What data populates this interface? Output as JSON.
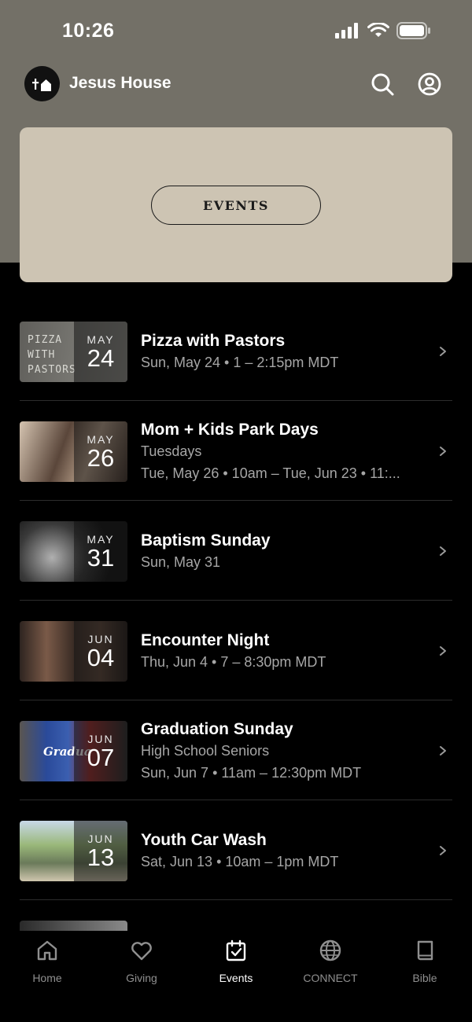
{
  "status_bar": {
    "time": "10:26"
  },
  "header": {
    "church_name": "Jesus House"
  },
  "hero": {
    "events_label": "EVENTS"
  },
  "events": [
    {
      "month": "MAY",
      "day": "24",
      "title": "Pizza with Pastors",
      "lines": [
        "Sun, May 24 • 1 – 2:15pm MDT"
      ],
      "thumb_colors": [
        "#6a6a66",
        "#8a8983"
      ],
      "thumb_text": "PIZZA WITH PASTORS"
    },
    {
      "month": "MAY",
      "day": "26",
      "title": "Mom + Kids Park Days",
      "lines": [
        "Tuesdays",
        "Tue, May 26 • 10am – Tue, Jun 23 • 11:..."
      ],
      "thumb_colors": [
        "#c9b8a6",
        "#4a3b32"
      ]
    },
    {
      "month": "MAY",
      "day": "31",
      "title": "Baptism Sunday",
      "lines": [
        "Sun, May 31"
      ],
      "thumb_colors": [
        "#1a1a1a",
        "#9a9a9a"
      ]
    },
    {
      "month": "JUN",
      "day": "04",
      "title": "Encounter Night",
      "lines": [
        "Thu, Jun 4 • 7 – 8:30pm MDT"
      ],
      "thumb_colors": [
        "#3b2f29",
        "#7a5a48"
      ]
    },
    {
      "month": "JUN",
      "day": "07",
      "title": "Graduation Sunday",
      "lines": [
        "High School Seniors",
        "Sun, Jun 7 • 11am – 12:30pm MDT"
      ],
      "thumb_colors": [
        "#2a4a8a",
        "#8a2a2a"
      ],
      "thumb_text": "Gradua"
    },
    {
      "month": "JUN",
      "day": "13",
      "title": "Youth Car Wash",
      "lines": [
        "Sat, Jun 13 • 10am – 1pm MDT"
      ],
      "thumb_colors": [
        "#8aa86a",
        "#c9c0a0"
      ]
    }
  ],
  "tabs": [
    {
      "label": "Home",
      "icon": "home-icon",
      "active": false
    },
    {
      "label": "Giving",
      "icon": "heart-icon",
      "active": false
    },
    {
      "label": "Events",
      "icon": "calendar-check-icon",
      "active": true
    },
    {
      "label": "CONNECT",
      "icon": "globe-icon",
      "active": false
    },
    {
      "label": "Bible",
      "icon": "book-icon",
      "active": false
    }
  ],
  "colors": {
    "header_bg": "#737067",
    "hero_bg": "#cdc4b3",
    "page_bg": "#000000",
    "muted_text": "#a6a6a6"
  }
}
